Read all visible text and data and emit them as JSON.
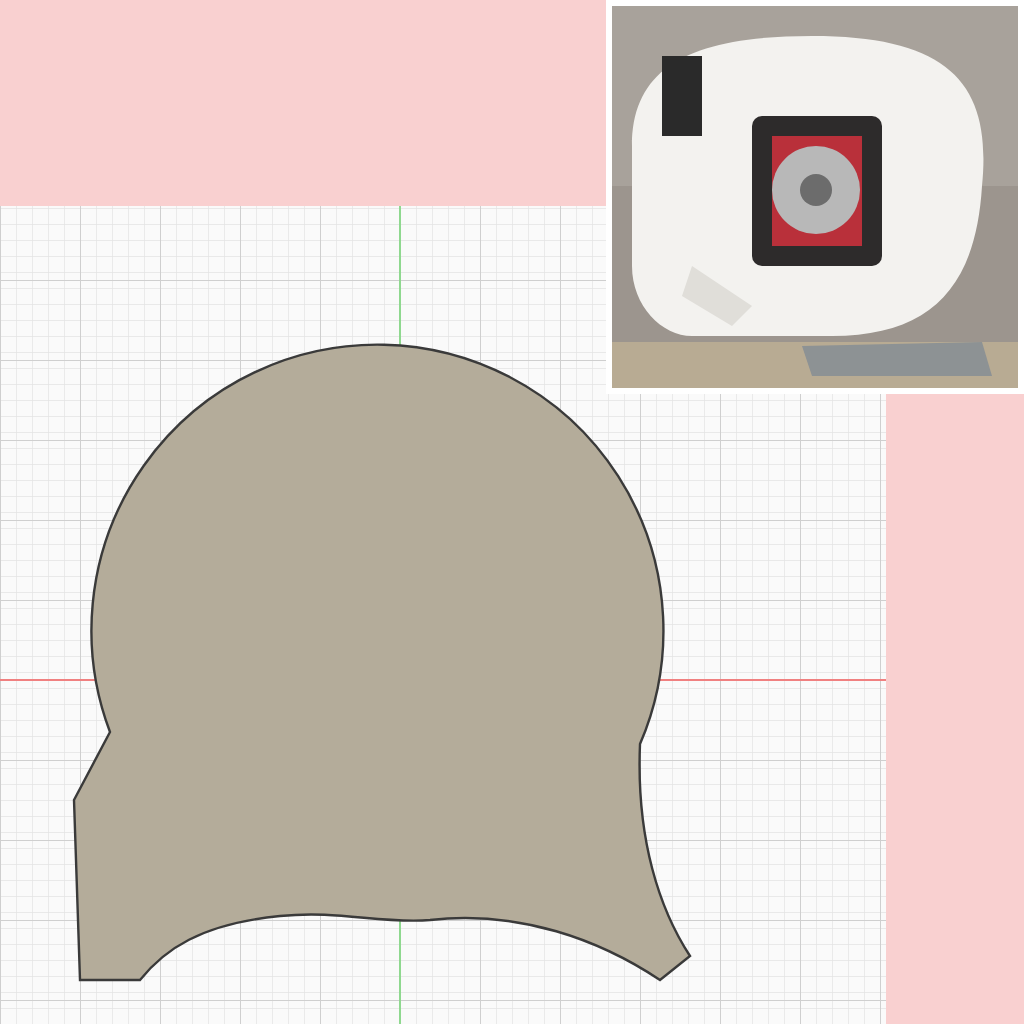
{
  "canvas": {
    "kind": "sketch"
  }
}
